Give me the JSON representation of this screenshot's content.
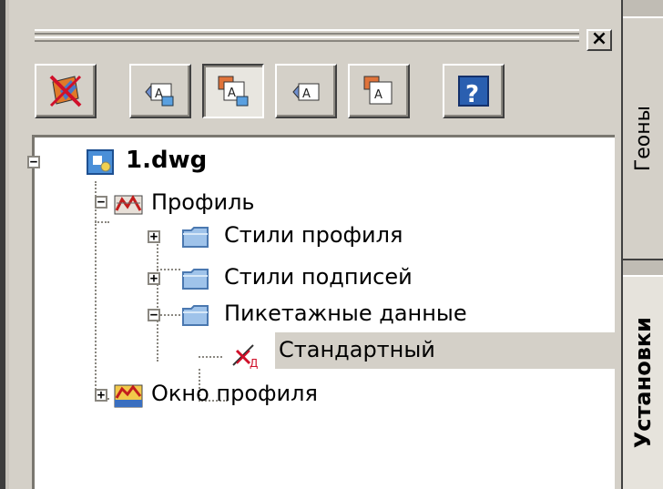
{
  "toolbar": {
    "buttons": [
      {
        "name": "delete-style",
        "icon": "cross-style-icon"
      },
      {
        "name": "new-label-style",
        "icon": "label-new-icon"
      },
      {
        "name": "label-style-pressed",
        "icon": "label-set-icon",
        "pressed": true
      },
      {
        "name": "edit-label",
        "icon": "label-edit-icon"
      },
      {
        "name": "label-set",
        "icon": "label-multi-icon"
      },
      {
        "name": "help",
        "icon": "help-icon",
        "label": "?"
      }
    ]
  },
  "close_label": "×",
  "tree": {
    "root": {
      "label": "1.dwg",
      "expander": "−"
    },
    "profile": {
      "label": "Профиль",
      "expander": "−"
    },
    "profile_styles": {
      "label": "Стили профиля",
      "expander": "+"
    },
    "label_styles": {
      "label": "Стили подписей",
      "expander": "+"
    },
    "station_data": {
      "label": "Пикетажные данные",
      "expander": "−"
    },
    "standard": {
      "label": "Стандартный",
      "selected": true
    },
    "profile_view": {
      "label": "Окно профиля",
      "expander": "+"
    }
  },
  "tabs": {
    "geony": "Геоны",
    "ustanovki": "Установки",
    "active": "Установки"
  },
  "colors": {
    "panel": "#d4d0c8",
    "folder": "#7fa9d8",
    "red_icon": "#cc2222",
    "selection": "#d4d0c8"
  }
}
